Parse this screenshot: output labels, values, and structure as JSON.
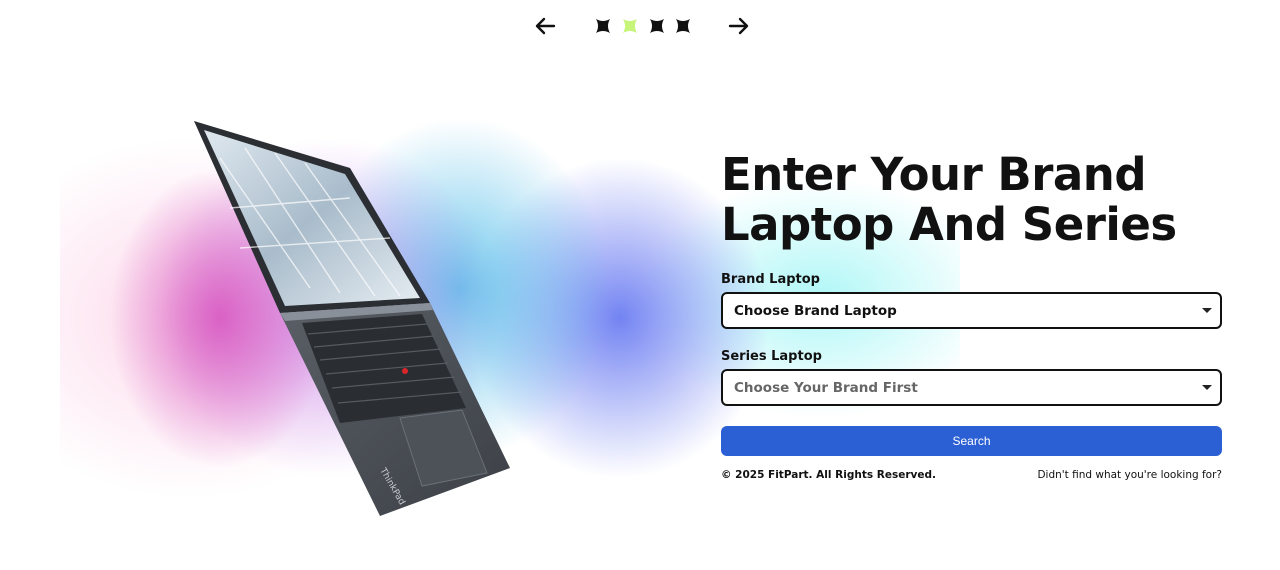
{
  "carousel": {
    "prev_icon": "arrow-left-icon",
    "next_icon": "arrow-right-icon",
    "active_index": 1,
    "slide_count": 4,
    "dot_color": "#111111",
    "active_dot_color": "#c6f57a"
  },
  "hero": {
    "headline": "Enter Your Brand Laptop And Series"
  },
  "form": {
    "brand_label": "Brand Laptop",
    "brand_value": "Choose Brand Laptop",
    "series_label": "Series Laptop",
    "series_value": "Choose Your Brand First",
    "search_label": "Search",
    "accent": "#2b5fd4"
  },
  "footer": {
    "copyright": "© 2025 FitPart. All Rights Reserved.",
    "help_link": "Didn't find what you're looking for?"
  }
}
